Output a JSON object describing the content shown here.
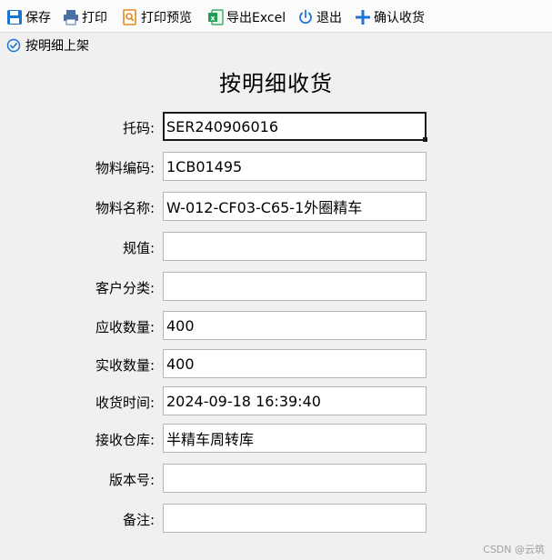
{
  "toolbar": {
    "save": "保存",
    "print": "打印",
    "preview": "打印预览",
    "export": "导出Excel",
    "exit": "退出",
    "confirm": "确认收货"
  },
  "subtoolbar": {
    "shelve": "按明细上架"
  },
  "form": {
    "title": "按明细收货",
    "fields": [
      {
        "label": "托码:",
        "value": "SER240906016"
      },
      {
        "label": "物料编码:",
        "value": "1CB01495"
      },
      {
        "label": "物料名称:",
        "value": "W-012-CF03-C65-1外圈精车"
      },
      {
        "label": "规值:",
        "value": ""
      },
      {
        "label": "客户分类:",
        "value": ""
      },
      {
        "label": "应收数量:",
        "value": "400"
      },
      {
        "label": "实收数量:",
        "value": "400"
      },
      {
        "label": "收货时间:",
        "value": "2024-09-18 16:39:40"
      },
      {
        "label": "接收仓库:",
        "value": "半精车周转库"
      },
      {
        "label": "版本号:",
        "value": ""
      },
      {
        "label": "备注:",
        "value": ""
      }
    ]
  },
  "watermark": "CSDN @云筑",
  "colors": {
    "accent": "#1e73d2",
    "print_icon": "#4a6fa5",
    "preview_icon": "#e08a1e",
    "excel_icon": "#1f9d55"
  }
}
